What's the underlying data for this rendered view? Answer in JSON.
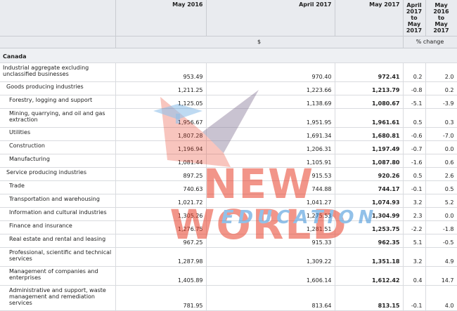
{
  "header": {
    "col_may2016": "May 2016",
    "col_apr2017": "April 2017",
    "col_may2017": "May 2017",
    "col_pct1": [
      "April",
      "2017",
      "to",
      "May",
      "2017"
    ],
    "col_pct2": [
      "May",
      "2016",
      "to",
      "May",
      "2017"
    ],
    "unit_dollars": "$",
    "unit_pct": "% change"
  },
  "section": "Canada",
  "rows": [
    {
      "label": "Industrial aggregate excluding unclassified businesses",
      "may2016": "953.49",
      "apr2017": "970.40",
      "may2017": "972.41",
      "pct1": "0.2",
      "pct2": "2.0"
    },
    {
      "label": "Goods producing industries",
      "may2016": "1,211.25",
      "apr2017": "1,223.66",
      "may2017": "1,213.79",
      "pct1": "-0.8",
      "pct2": "0.2"
    },
    {
      "label": "Forestry, logging and support",
      "may2016": "1,125.05",
      "apr2017": "1,138.69",
      "may2017": "1,080.67",
      "pct1": "-5.1",
      "pct2": "-3.9"
    },
    {
      "label": "Mining, quarrying, and oil and gas extraction",
      "may2016": "1,956.67",
      "apr2017": "1,951.95",
      "may2017": "1,961.61",
      "pct1": "0.5",
      "pct2": "0.3"
    },
    {
      "label": "Utilities",
      "may2016": "1,807.28",
      "apr2017": "1,691.34",
      "may2017": "1,680.81",
      "pct1": "-0.6",
      "pct2": "-7.0"
    },
    {
      "label": "Construction",
      "may2016": "1,196.94",
      "apr2017": "1,206.31",
      "may2017": "1,197.49",
      "pct1": "-0.7",
      "pct2": "0.0"
    },
    {
      "label": "Manufacturing",
      "may2016": "1,081.44",
      "apr2017": "1,105.91",
      "may2017": "1,087.80",
      "pct1": "-1.6",
      "pct2": "0.6"
    },
    {
      "label": "Service producing industries",
      "may2016": "897.25",
      "apr2017": "915.53",
      "may2017": "920.26",
      "pct1": "0.5",
      "pct2": "2.6"
    },
    {
      "label": "Trade",
      "may2016": "740.63",
      "apr2017": "744.88",
      "may2017": "744.17",
      "pct1": "-0.1",
      "pct2": "0.5"
    },
    {
      "label": "Transportation and warehousing",
      "may2016": "1,021.72",
      "apr2017": "1,041.27",
      "may2017": "1,074.93",
      "pct1": "3.2",
      "pct2": "5.2"
    },
    {
      "label": "Information and cultural industries",
      "may2016": "1,305.26",
      "apr2017": "1,275.53",
      "may2017": "1,304.99",
      "pct1": "2.3",
      "pct2": "0.0"
    },
    {
      "label": "Finance and insurance",
      "may2016": "1,276.75",
      "apr2017": "1,281.51",
      "may2017": "1,253.75",
      "pct1": "-2.2",
      "pct2": "-1.8"
    },
    {
      "label": "Real estate and rental and leasing",
      "may2016": "967.25",
      "apr2017": "915.33",
      "may2017": "962.35",
      "pct1": "5.1",
      "pct2": "-0.5"
    },
    {
      "label": "Professional, scientific and technical services",
      "may2016": "1,287.98",
      "apr2017": "1,309.22",
      "may2017": "1,351.18",
      "pct1": "3.2",
      "pct2": "4.9"
    },
    {
      "label": "Management of companies and enterprises",
      "may2016": "1,405.89",
      "apr2017": "1,606.14",
      "may2017": "1,612.42",
      "pct1": "0.4",
      "pct2": "14.7"
    },
    {
      "label": "Administrative and support, waste management and remediation services",
      "may2016": "781.95",
      "apr2017": "813.64",
      "may2017": "813.15",
      "pct1": "-0.1",
      "pct2": "4.0"
    }
  ],
  "watermark": {
    "line1": "NEW WORLD",
    "line2": "EDUCATION",
    "color_red": "#e8402a",
    "color_blue": "#3a8fd8"
  }
}
